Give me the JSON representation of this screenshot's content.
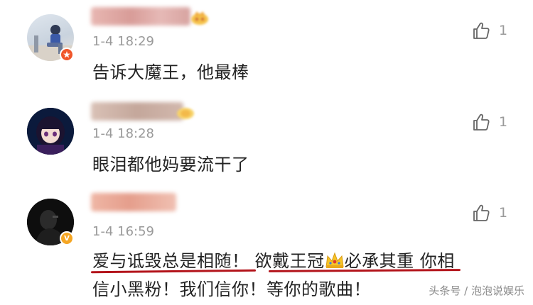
{
  "comments": [
    {
      "timestamp": "1-4 18:29",
      "text": "告诉大魔王，他最棒",
      "like_count": "1",
      "avatar_badge_icon": "orange-star-badge-icon",
      "level_badge_icon": "crown-level-badge-icon"
    },
    {
      "timestamp": "1-4 18:28",
      "text": "眼泪都他妈要流干了",
      "like_count": "1",
      "level_badge_icon": "level-badge-icon"
    },
    {
      "timestamp": "1-4 16:59",
      "text_part1": "爱与诋毁总是相随！",
      "text_part2": "欲戴王冠",
      "text_part3": "必承其重",
      "text_part4": " 你相",
      "text_line2": "信小黑粉！我们信你！等你的歌曲！",
      "like_count": "1",
      "avatar_badge": "V",
      "avatar_badge_icon": "verified-v-badge-icon"
    }
  ],
  "watermark": "头条号 / 泡泡说娱乐",
  "colors": {
    "underline": "#b3141b",
    "timestamp": "#9a9a9a",
    "verified_badge": "#f5a623",
    "star_badge": "#f0562a"
  }
}
